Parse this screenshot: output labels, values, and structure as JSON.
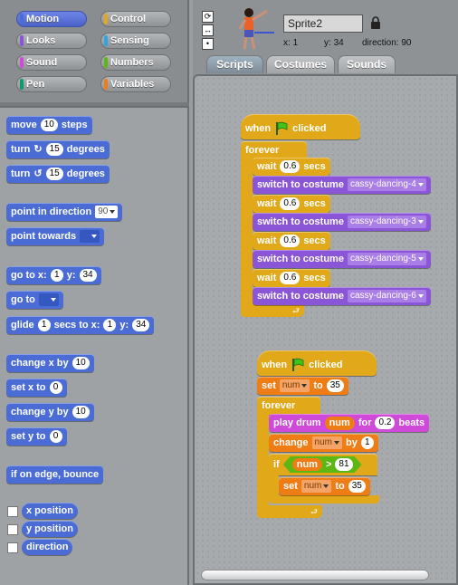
{
  "categories": {
    "left": [
      {
        "label": "Motion",
        "color": "#4a6cd4",
        "selected": true
      },
      {
        "label": "Looks",
        "color": "#8a55d7",
        "selected": false
      },
      {
        "label": "Sound",
        "color": "#cf4ad9",
        "selected": false
      },
      {
        "label": "Pen",
        "color": "#0e9a6c",
        "selected": false
      }
    ],
    "right": [
      {
        "label": "Control",
        "color": "#e1a91a",
        "selected": false
      },
      {
        "label": "Sensing",
        "color": "#2ca5e2",
        "selected": false
      },
      {
        "label": "Numbers",
        "color": "#5cb712",
        "selected": false
      },
      {
        "label": "Variables",
        "color": "#ee7d16",
        "selected": false
      }
    ]
  },
  "palette": {
    "move": {
      "label": "move",
      "value": "10",
      "suffix": "steps"
    },
    "turn_right": {
      "label": "turn",
      "icon": "↻",
      "value": "15",
      "suffix": "degrees"
    },
    "turn_left": {
      "label": "turn",
      "icon": "↺",
      "value": "15",
      "suffix": "degrees"
    },
    "point_dir": {
      "label": "point in direction",
      "value": "90"
    },
    "point_towards": {
      "label": "point towards"
    },
    "goto_xy": {
      "label": "go to x:",
      "x": "1",
      "ylabel": "y:",
      "y": "34"
    },
    "goto": {
      "label": "go to"
    },
    "glide": {
      "label": "glide",
      "secs": "1",
      "mid": "secs to x:",
      "x": "1",
      "ylabel": "y:",
      "y": "34"
    },
    "change_x": {
      "label": "change x by",
      "value": "10"
    },
    "set_x": {
      "label": "set x to",
      "value": "0"
    },
    "change_y": {
      "label": "change y by",
      "value": "10"
    },
    "set_y": {
      "label": "set y to",
      "value": "0"
    },
    "bounce": {
      "label": "if on edge, bounce"
    },
    "x_position": {
      "label": "x position"
    },
    "y_position": {
      "label": "y position"
    },
    "direction": {
      "label": "direction"
    }
  },
  "sprite": {
    "name": "Sprite2",
    "x_label": "x:",
    "x": "1",
    "y_label": "y:",
    "y": "34",
    "dir_label": "direction:",
    "direction": "90"
  },
  "tabs": [
    {
      "label": "Scripts",
      "active": true
    },
    {
      "label": "Costumes",
      "active": false
    },
    {
      "label": "Sounds",
      "active": false
    }
  ],
  "script1": {
    "hat_when": "when",
    "hat_clicked": "clicked",
    "forever": "forever",
    "wait_label": "wait",
    "wait_value": "0.6",
    "secs": "secs",
    "switch_label": "switch to costume",
    "costumes": [
      "cassy-dancing-4",
      "cassy-dancing-3",
      "cassy-dancing-5",
      "cassy-dancing-6"
    ]
  },
  "script2": {
    "hat_when": "when",
    "hat_clicked": "clicked",
    "set_label": "set",
    "var": "num",
    "to": "to",
    "set_value": "35",
    "forever": "forever",
    "play_drum": "play drum",
    "for": "for",
    "beats_value": "0.2",
    "beats": "beats",
    "change_label": "change",
    "by": "by",
    "change_value": "1",
    "if_label": "if",
    "cmp_op": ">",
    "cmp_value": "81",
    "inner_set_value": "35"
  }
}
